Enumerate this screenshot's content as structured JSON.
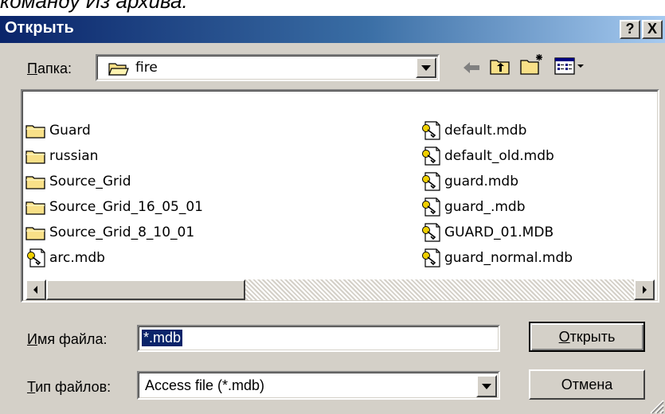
{
  "caption_fragment": "команду Из архива:",
  "dialog": {
    "title": "Открыть",
    "help_label": "?",
    "close_label": "X"
  },
  "lookin": {
    "label_hotkey": "П",
    "label_rest": "апка:",
    "value": "fire"
  },
  "files": {
    "column1": [
      {
        "name": "Guard",
        "type": "folder"
      },
      {
        "name": "russian",
        "type": "folder"
      },
      {
        "name": "Source_Grid",
        "type": "folder"
      },
      {
        "name": "Source_Grid_16_05_01",
        "type": "folder"
      },
      {
        "name": "Source_Grid_8_10_01",
        "type": "folder"
      },
      {
        "name": "arc.mdb",
        "type": "mdb"
      }
    ],
    "column2": [
      {
        "name": "default.mdb",
        "type": "mdb"
      },
      {
        "name": "default_old.mdb",
        "type": "mdb"
      },
      {
        "name": "guard.mdb",
        "type": "mdb"
      },
      {
        "name": "guard_.mdb",
        "type": "mdb"
      },
      {
        "name": "GUARD_01.MDB",
        "type": "mdb"
      },
      {
        "name": "guard_normal.mdb",
        "type": "mdb"
      }
    ]
  },
  "filename": {
    "label_hotkey": "И",
    "label_rest": "мя файла:",
    "value": "*.mdb"
  },
  "filetype": {
    "label_hotkey": "Т",
    "label_rest": "ип файлов:",
    "value": "Access file (*.mdb)"
  },
  "buttons": {
    "open_hotkey": "О",
    "open_rest": "ткрыть",
    "cancel": "Отмена"
  },
  "colors": {
    "dialog_bg": "#d4d0c8",
    "title_start": "#0a246a",
    "title_end": "#a6caf0",
    "selection": "#0a246a",
    "folder_yellow": "#f8e088"
  }
}
